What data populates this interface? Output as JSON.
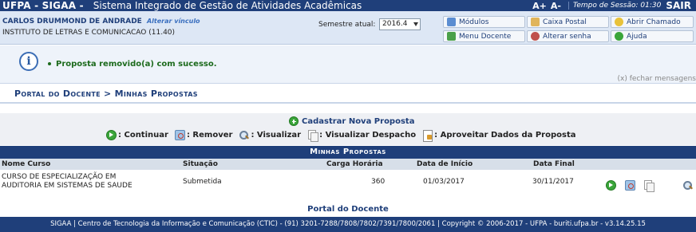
{
  "topbar": {
    "brand": "UFPA - SIGAA -",
    "system_name": "Sistema Integrado de Gestão de Atividades Acadêmicas",
    "font_increase": "A+",
    "font_decrease": "A-",
    "session_label": "Tempo de Sessão: 01:30",
    "logout": "SAIR"
  },
  "user": {
    "name": "CARLOS DRUMMOND DE ANDRADE",
    "change_link": "Alterar vínculo",
    "institute": "INSTITUTO DE LETRAS E COMUNICACAO (11.40)",
    "semester_label": "Semestre atual:",
    "semester_value": "2016.4"
  },
  "quick_links": {
    "modulos": "Módulos",
    "caixa_postal": "Caixa Postal",
    "abrir_chamado": "Abrir Chamado",
    "menu_docente": "Menu Docente",
    "alterar_senha": "Alterar senha",
    "ajuda": "Ajuda"
  },
  "message": {
    "text": "Proposta removido(a) com sucesso.",
    "close": "(x) fechar mensagens"
  },
  "breadcrumb": "Portal do Docente > Minhas Propostas",
  "actions": {
    "new_proposal": "Cadastrar Nova Proposta",
    "legend": {
      "continuar": ": Continuar",
      "remover": ": Remover",
      "visualizar": ": Visualizar",
      "visualizar_despacho": ": Visualizar Despacho",
      "aproveitar": ": Aproveitar Dados da Proposta"
    }
  },
  "table": {
    "caption": "Minhas Propostas",
    "headers": {
      "nome": "Nome Curso",
      "situacao": "Situação",
      "carga": "Carga Horária",
      "inicio": "Data de Início",
      "final": "Data Final"
    },
    "rows": [
      {
        "nome_l1": "CURSO DE ESPECIALIZAÇÃO EM",
        "nome_l2": "AUDITORIA EM SISTEMAS DE SAUDE",
        "situacao": "Submetida",
        "carga": "360",
        "inicio": "01/03/2017",
        "final": "30/11/2017"
      }
    ]
  },
  "portal_link": "Portal do Docente",
  "footer": "SIGAA | Centro de Tecnologia da Informação e Comunicação (CTIC) - (91) 3201-7288/7808/7802/7391/7800/2061 | Copyright © 2006-2017 - UFPA - buriti.ufpa.br - v3.14.25.15",
  "colors": {
    "header_blue": "#1f3f7a",
    "success_green": "#1c6a1c",
    "user_band": "#dde7f5"
  }
}
